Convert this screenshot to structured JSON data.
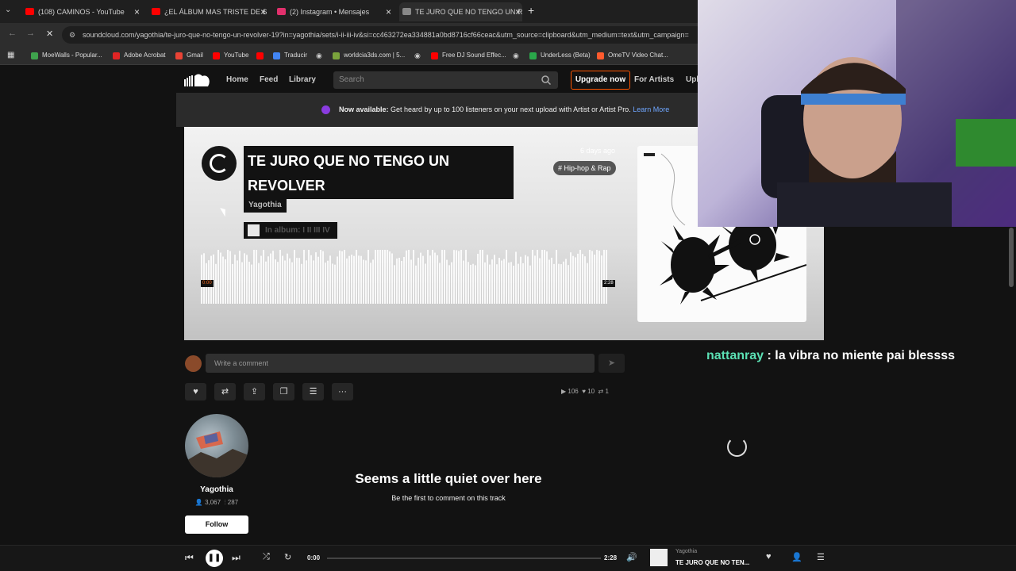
{
  "browser": {
    "tabs": [
      {
        "label": "(108) CAMINOS - YouTube",
        "color": "#ff0000"
      },
      {
        "label": "¿EL ÁLBUM MAS TRISTE DE SUI",
        "color": "#ff0000"
      },
      {
        "label": "(2) Instagram • Mensajes",
        "color": "#e1306c"
      },
      {
        "label": "TE JURO QUE NO TENGO UN R",
        "color": "#888888"
      }
    ],
    "new_tab": "+",
    "url": "soundcloud.com/yagothia/te-juro-que-no-tengo-un-revolver-19?in=yagothia/sets/i-ii-iii-iv&si=cc463272ea334881a0bd8716cf66ceac&utm_source=clipboard&utm_medium=text&utm_campaign=",
    "bookmarks": [
      {
        "label": "MoeWalls - Popular...",
        "color": "#3fa34d"
      },
      {
        "label": "Adobe Acrobat",
        "color": "#e02424"
      },
      {
        "label": "Gmail",
        "color": "#ea4335"
      },
      {
        "label": "YouTube",
        "color": "#ff0000"
      },
      {
        "label": "Traducir",
        "color": "#4285f4"
      },
      {
        "label": "worldcia3ds.com | 5...",
        "color": "#7aa33c"
      },
      {
        "label": "Free DJ Sound Effec...",
        "color": "#ff0000"
      },
      {
        "label": "UnderLess (Beta)",
        "color": "#2aa84a"
      },
      {
        "label": "OmeTV Video Chat...",
        "color": "#ff5b2e"
      }
    ]
  },
  "header": {
    "home": "Home",
    "feed": "Feed",
    "library": "Library",
    "search_placeholder": "Search",
    "upgrade": "Upgrade now",
    "for_artists": "For Artists",
    "upload": "Upl"
  },
  "banner": {
    "bold": "Now available:",
    "text": " Get heard by up to 100 listeners on your next upload with Artist or Artist Pro. ",
    "link": "Learn More"
  },
  "track": {
    "title": "TE JURO QUE NO TENGO UN REVOLVER",
    "artist": "Yagothia",
    "album": "In album: I II III IV",
    "date": "6 days ago",
    "genre": "# Hip-hop & Rap",
    "time_current": "0:00",
    "time_total": "2:28"
  },
  "comments": {
    "placeholder": "Write a comment",
    "empty_title": "Seems a little quiet over here",
    "empty_sub": "Be the first to comment on this track"
  },
  "stats": {
    "plays": "106",
    "likes": "10",
    "reposts": "1"
  },
  "artist_card": {
    "name": "Yagothia",
    "followers": "3,067",
    "tracks": "287",
    "follow": "Follow"
  },
  "player": {
    "current": "0:00",
    "total": "2:28",
    "progress": 0.0,
    "artist": "Yagothia",
    "title": "TE JURO QUE NO TEN..."
  },
  "chat": {
    "user": "nattanray",
    "message": " : la vibra no miente pai blessss"
  },
  "icons": [
    "soundcloud-logo-icon",
    "search-icon",
    "send-icon",
    "heart-icon",
    "repost-icon",
    "share-icon",
    "copy-link-icon",
    "add-to-queue-icon",
    "more-icon",
    "play-icon",
    "previous-icon",
    "pause-icon",
    "next-icon",
    "shuffle-icon",
    "repeat-icon",
    "volume-icon",
    "follow-user-icon",
    "queue-icon"
  ]
}
